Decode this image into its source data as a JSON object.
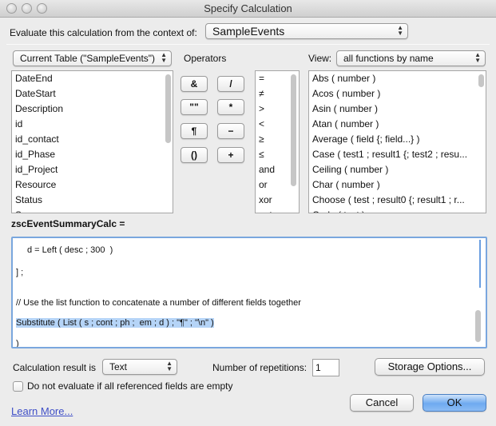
{
  "window": {
    "title": "Specify Calculation"
  },
  "context": {
    "label": "Evaluate this calculation from the context of:",
    "value": "SampleEvents"
  },
  "fields_panel": {
    "table_popup": "Current Table (\"SampleEvents\")",
    "items": [
      "DateEnd",
      "DateStart",
      "Description",
      "id",
      "id_contact",
      "id_Phase",
      "id_Project",
      "Resource",
      "Status",
      "Summary"
    ]
  },
  "operators_panel": {
    "label": "Operators",
    "buttons": [
      "&",
      "/",
      "\"\"",
      "*",
      "¶",
      "−",
      "()",
      "+"
    ],
    "list": [
      "=",
      "≠",
      ">",
      "<",
      "≥",
      "≤",
      "and",
      "or",
      "xor",
      "not"
    ]
  },
  "functions_panel": {
    "view_label": "View:",
    "view_value": "all functions by name",
    "items": [
      "Abs ( number )",
      "Acos ( number )",
      "Asin ( number )",
      "Atan ( number )",
      "Average ( field {; field...} )",
      "Case ( test1 ; result1 {; test2 ; resu...",
      "Ceiling ( number )",
      "Char ( number )",
      "Choose ( test ; result0 {; result1 ; r...",
      "Code ( text )"
    ]
  },
  "calculation": {
    "field_name": "zscEventSummaryCalc =",
    "lines": [
      "d = Left ( desc ; 300  )",
      "] ;",
      "// Use the list function to concatenate a number of different fields together",
      "Substitute ( List ( s ; cont ; ph ;  em ; d ) ; \"¶\" ; \"\\n\" )",
      ")"
    ]
  },
  "result": {
    "label": "Calculation result is",
    "value": "Text",
    "repetitions_label": "Number of repetitions:",
    "repetitions_value": "1",
    "storage_button": "Storage Options..."
  },
  "options": {
    "do_not_evaluate_label": "Do not evaluate if all referenced fields are empty",
    "do_not_evaluate_checked": false
  },
  "footer": {
    "learn_more": "Learn More...",
    "cancel": "Cancel",
    "ok": "OK"
  }
}
